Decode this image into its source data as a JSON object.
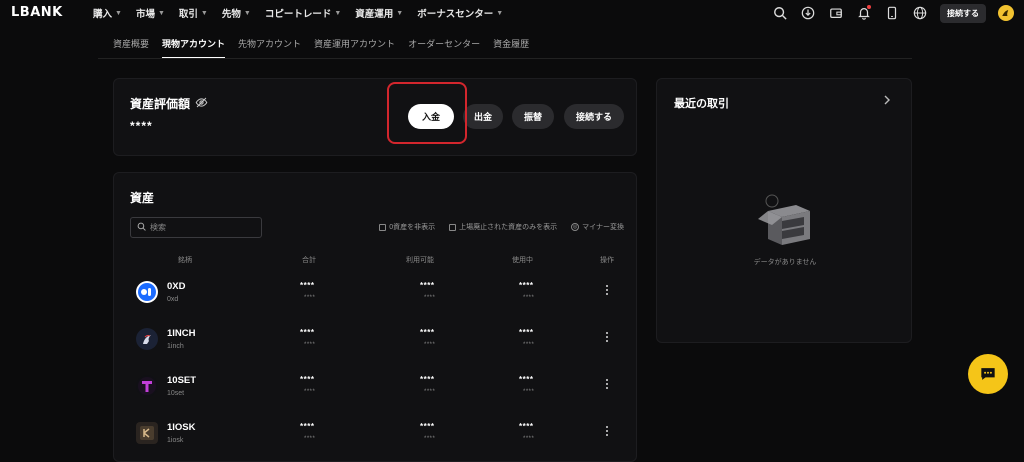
{
  "header": {
    "logo": "LBANK",
    "menu": [
      {
        "label": "購入"
      },
      {
        "label": "市場"
      },
      {
        "label": "取引"
      },
      {
        "label": "先物"
      },
      {
        "label": "コピートレード"
      },
      {
        "label": "資産運用"
      },
      {
        "label": "ボーナスセンター"
      }
    ],
    "login_label": "接続する"
  },
  "subnav": {
    "tabs": [
      {
        "label": "資産概要"
      },
      {
        "label": "現物アカウント",
        "active": true
      },
      {
        "label": "先物アカウント"
      },
      {
        "label": "資産運用アカウント"
      },
      {
        "label": "オーダーセンター"
      },
      {
        "label": "資金履歴"
      }
    ]
  },
  "valuation": {
    "title": "資産評価額",
    "amount": "****",
    "buttons": {
      "deposit": "入金",
      "withdraw": "出金",
      "transfer": "振替",
      "connect": "接続する"
    }
  },
  "assets": {
    "title": "資産",
    "search_placeholder": "検索",
    "filters": {
      "hide_zero": "0資産を非表示",
      "hide_delisted": "上場廃止された資産のみを表示",
      "mini_convert": "マイナー変換"
    },
    "columns": {
      "name": "銘柄",
      "total": "合計",
      "available": "利用可能",
      "in_use": "使用中",
      "action": "操作"
    },
    "rows": [
      {
        "symbol": "0XD",
        "sub": "0xd",
        "total": "****",
        "total_sub": "****",
        "available": "****",
        "available_sub": "****",
        "in_use": "****",
        "in_use_sub": "****"
      },
      {
        "symbol": "1INCH",
        "sub": "1inch",
        "total": "****",
        "total_sub": "****",
        "available": "****",
        "available_sub": "****",
        "in_use": "****",
        "in_use_sub": "****"
      },
      {
        "symbol": "10SET",
        "sub": "10set",
        "total": "****",
        "total_sub": "****",
        "available": "****",
        "available_sub": "****",
        "in_use": "****",
        "in_use_sub": "****"
      },
      {
        "symbol": "1IOSK",
        "sub": "1iosk",
        "total": "****",
        "total_sub": "****",
        "available": "****",
        "available_sub": "****",
        "in_use": "****",
        "in_use_sub": "****"
      }
    ]
  },
  "recent": {
    "title": "最近の取引",
    "empty_text": "データがありません"
  },
  "colors": {
    "accent": "#f5c518",
    "highlight": "#d3262d",
    "background": "#0b0b0c"
  }
}
